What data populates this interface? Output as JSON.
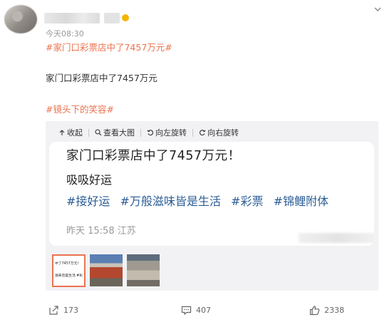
{
  "post": {
    "timestamp": "今天08:30",
    "topic_top": "#家门口彩票店中了7457万元#",
    "text": "家门口彩票店中了7457万元",
    "topic_2": "#镜头下的笑容#"
  },
  "toolbar": {
    "collapse": "收起",
    "view_large": "查看大图",
    "rotate_left": "向左旋转",
    "rotate_right": "向右旋转"
  },
  "embedded": {
    "title": "家门口彩票店中了7457万元！",
    "line2": "吸吸好运",
    "tags": [
      "#接好运",
      "#万般滋味皆是生活",
      "#彩票",
      "#锦鲤附体"
    ],
    "meta": "昨天 15:58 江苏"
  },
  "thumbnails": [
    {
      "lines": [
        "中了7457万元！",
        "滋味皆是生活 #彩"
      ]
    },
    {
      "lines": []
    },
    {
      "lines": []
    }
  ],
  "actions": {
    "share_count": "173",
    "comment_count": "407",
    "like_count": "2338"
  },
  "colors": {
    "topic": "#eb7350",
    "tag_blue": "#2b5d95",
    "card_bg": "#f2f2f5"
  }
}
